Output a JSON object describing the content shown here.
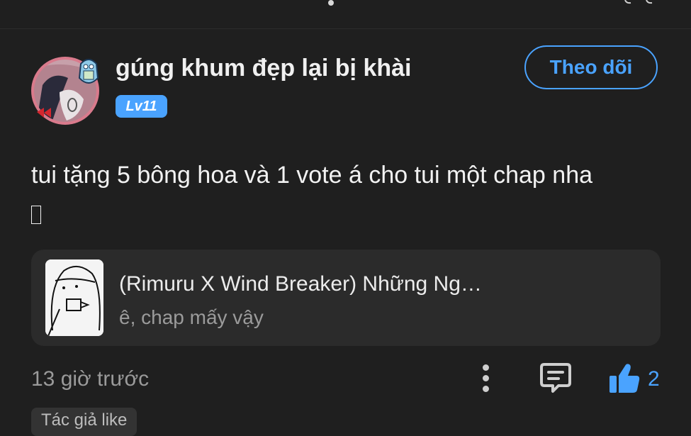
{
  "post": {
    "username": "gúng khum đẹp lại bị khài",
    "level": "Lv11",
    "follow_label": "Theo dõi",
    "comment_text": "tui tặng 5 bông hoa và 1 vote á cho tui một chap nha",
    "story": {
      "title": "(Rimuru X Wind Breaker) Những Ng…",
      "subtitle": "ê, chap mấy vậy"
    },
    "timestamp": "13 giờ trước",
    "like_count": "2",
    "tag_label": "Tác giả like"
  },
  "colors": {
    "background": "#1f1f1f",
    "card": "#2b2b2b",
    "accent": "#4aa3ff",
    "muted_text": "#9a9a9a"
  },
  "icons": [
    "more-vertical-icon",
    "reply-icon",
    "like-icon"
  ]
}
